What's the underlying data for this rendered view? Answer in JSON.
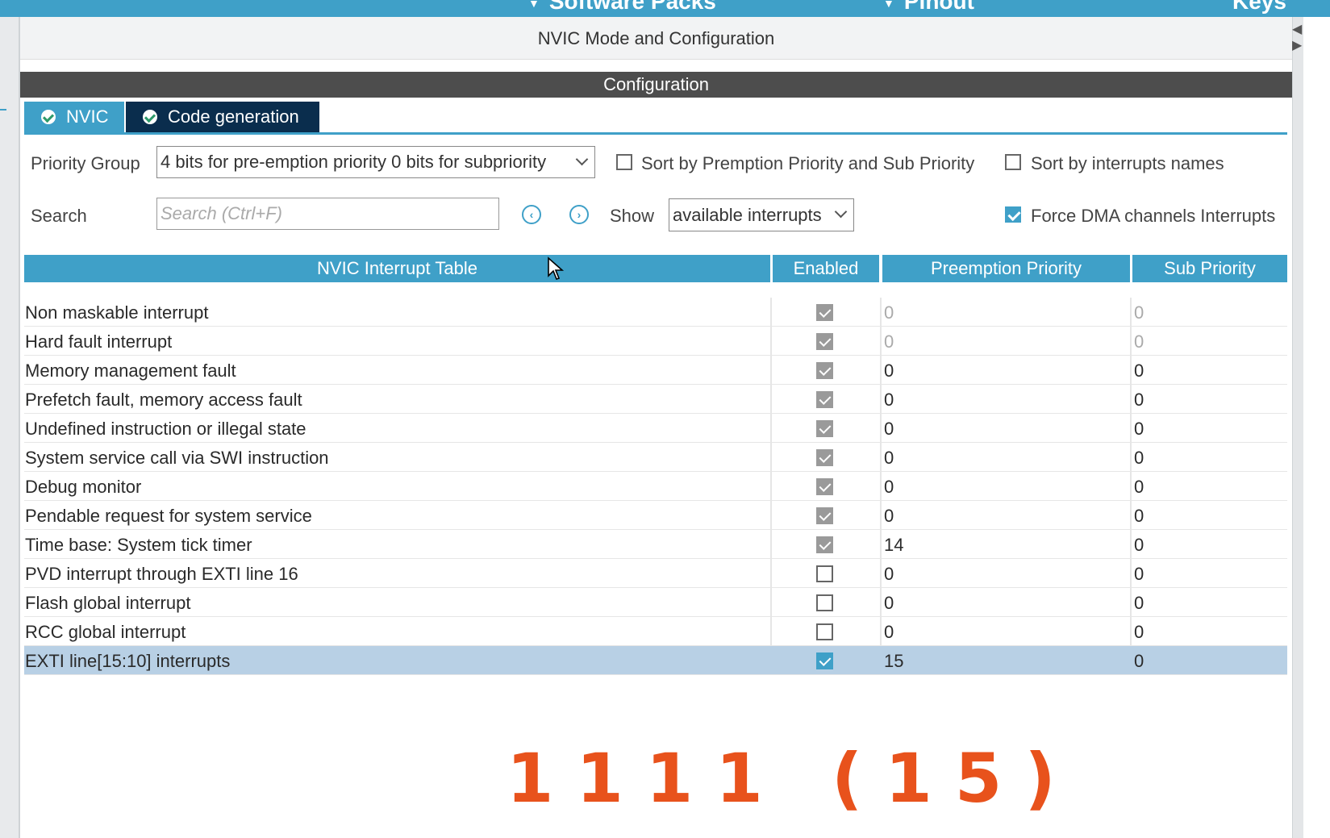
{
  "topbar": {
    "menu1": "Software Packs",
    "menu2": "Pinout",
    "brand": "Keys"
  },
  "header": {
    "title": "NVIC Mode and Configuration"
  },
  "config_bar": {
    "title": "Configuration"
  },
  "tabs": [
    {
      "label": "NVIC"
    },
    {
      "label": "Code generation"
    }
  ],
  "priority_group": {
    "label": "Priority Group",
    "value": "4 bits for pre-emption priority 0 bits for subpriority"
  },
  "sort_preemption": {
    "label": "Sort by Premption Priority and Sub Priority",
    "checked": false
  },
  "sort_names": {
    "label": "Sort by interrupts names",
    "checked": false
  },
  "search": {
    "label": "Search",
    "placeholder": "Search (Ctrl+F)",
    "value": ""
  },
  "show": {
    "label": "Show",
    "value": "available interrupts"
  },
  "force_dma": {
    "label": "Force DMA channels Interrupts",
    "checked": true
  },
  "table": {
    "headers": [
      "NVIC Interrupt Table",
      "Enabled",
      "Preemption Priority",
      "Sub Priority"
    ],
    "rows": [
      {
        "name": "Non maskable interrupt",
        "enabled": true,
        "preemption": "0",
        "sub": "0",
        "locked": true
      },
      {
        "name": "Hard fault interrupt",
        "enabled": true,
        "preemption": "0",
        "sub": "0",
        "locked": true
      },
      {
        "name": "Memory management fault",
        "enabled": true,
        "preemption": "0",
        "sub": "0"
      },
      {
        "name": "Prefetch fault, memory access fault",
        "enabled": true,
        "preemption": "0",
        "sub": "0"
      },
      {
        "name": "Undefined instruction or illegal state",
        "enabled": true,
        "preemption": "0",
        "sub": "0"
      },
      {
        "name": "System service call via SWI instruction",
        "enabled": true,
        "preemption": "0",
        "sub": "0"
      },
      {
        "name": "Debug monitor",
        "enabled": true,
        "preemption": "0",
        "sub": "0"
      },
      {
        "name": "Pendable request for system service",
        "enabled": true,
        "preemption": "0",
        "sub": "0"
      },
      {
        "name": "Time base: System tick timer",
        "enabled": true,
        "preemption": "14",
        "sub": "0"
      },
      {
        "name": "PVD interrupt through EXTI line 16",
        "enabled": false,
        "preemption": "0",
        "sub": "0"
      },
      {
        "name": "Flash global interrupt",
        "enabled": false,
        "preemption": "0",
        "sub": "0"
      },
      {
        "name": "RCC global interrupt",
        "enabled": false,
        "preemption": "0",
        "sub": "0"
      },
      {
        "name": "EXTI line[15:10] interrupts",
        "enabled": true,
        "preemption": "15",
        "sub": "0",
        "selected": true
      }
    ]
  },
  "overlay_text": "1111 (15)",
  "colors": {
    "accent": "#3fa0c8",
    "dark_tab": "#0a2d4d",
    "overlay": "#e8521c",
    "selected_row": "#b8d0e5"
  }
}
